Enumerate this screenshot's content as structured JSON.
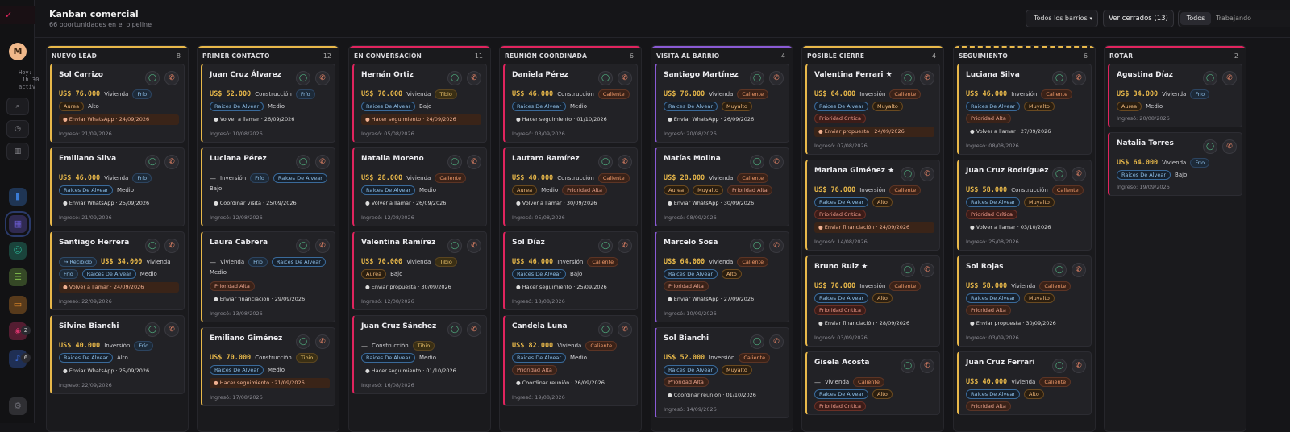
{
  "app": {
    "logo": "✓",
    "avatar": "M",
    "overlay": "Hoy:\n 1h 30\nactiv"
  },
  "sidebar": {
    "nav_top": [
      {
        "icon": "search-icon",
        "glyph": "⌕"
      },
      {
        "icon": "clock-icon",
        "glyph": "◷"
      },
      {
        "icon": "stats-icon",
        "glyph": "▥"
      }
    ],
    "nav_main": [
      {
        "icon": "chart-icon",
        "glyph": "▮",
        "color": "#3a7bd5"
      },
      {
        "icon": "kanban-icon",
        "glyph": "▦",
        "color": "#6a5acd"
      },
      {
        "icon": "users-icon",
        "glyph": "☺",
        "color": "#2aa58a"
      },
      {
        "icon": "tasks-icon",
        "glyph": "☰",
        "color": "#7ab34a"
      },
      {
        "icon": "chat-icon",
        "glyph": "▭",
        "color": "#e08a2a"
      },
      {
        "icon": "tag-icon",
        "glyph": "◈",
        "color": "#d6336c"
      },
      {
        "icon": "bell-icon",
        "glyph": "♪",
        "color": "#3a6ad5"
      },
      {
        "icon": "settings-icon",
        "glyph": "⚙",
        "color": "#6a6a72"
      }
    ],
    "badges": [
      "2",
      "6"
    ]
  },
  "header": {
    "title": "Kanban comercial",
    "subtitle": "66 oportunidades en el pipeline",
    "filter_selected": "Todos los barrios",
    "closed_button": "Ver cerrados (13)",
    "segments": [
      "Todos",
      "Trabajando"
    ]
  },
  "columns": [
    {
      "name": "NUEVO LEAD",
      "count": "8",
      "color": "#e8b84a",
      "dashed": false,
      "cards": [
        {
          "name": "Sol Carrizo",
          "money": "US$ 76.000",
          "type": "Vivienda",
          "tags": [
            {
              "t": "Frío",
              "c": "p-frio"
            }
          ],
          "tags2": [
            {
              "t": "Aurea",
              "c": "p-aur"
            }
          ],
          "tier": "Alto",
          "next": "Enviar WhatsApp · 24/09/2026",
          "nexthl": true,
          "ingreso": "Ingresó: 21/09/2026"
        },
        {
          "name": "Emiliano Silva",
          "money": "US$ 46.000",
          "type": "Vivienda",
          "tags": [
            {
              "t": "Frío",
              "c": "p-frio"
            }
          ],
          "tags2": [
            {
              "t": "Raices De Alvear",
              "c": "p-rda"
            }
          ],
          "tier": "Medio",
          "next": "Enviar WhatsApp · 25/09/2026",
          "nexthl": false,
          "ingreso": "Ingresó: 21/09/2026"
        },
        {
          "name": "Santiago Herrera",
          "pre": "↪ Recibido",
          "money": "US$ 34.000",
          "type": "Vivienda",
          "tags": [],
          "tags2": [
            {
              "t": "Frío",
              "c": "p-frio"
            },
            {
              "t": "Raices De Alvear",
              "c": "p-rda"
            }
          ],
          "tier": "Medio",
          "next": "Volver a llamar · 24/09/2026",
          "nexthl": true,
          "ingreso": "Ingresó: 22/09/2026"
        },
        {
          "name": "Silvina Bianchi",
          "money": "US$ 40.000",
          "type": "Inversión",
          "tags": [
            {
              "t": "Frío",
              "c": "p-frio"
            }
          ],
          "tags2": [
            {
              "t": "Raices De Alvear",
              "c": "p-rda"
            }
          ],
          "tier": "Alto",
          "next": "Enviar WhatsApp · 25/09/2026",
          "nexthl": false,
          "ingreso": "Ingresó: 22/09/2026"
        }
      ]
    },
    {
      "name": "PRIMER CONTACTO",
      "count": "12",
      "color": "#e8b84a",
      "dashed": false,
      "cards": [
        {
          "name": "Juan Cruz Álvarez",
          "money": "US$ 52.000",
          "type": "Construcción",
          "tags": [
            {
              "t": "Frío",
              "c": "p-frio"
            }
          ],
          "tags2": [
            {
              "t": "Raices De Alvear",
              "c": "p-rda"
            }
          ],
          "tier": "Medio",
          "next": "Volver a llamar · 26/09/2026",
          "nexthl": false,
          "ingreso": "Ingresó: 10/08/2026"
        },
        {
          "name": "Luciana Pérez",
          "dash": true,
          "money": "",
          "type": "Inversión",
          "tags": [
            {
              "t": "Frío",
              "c": "p-frio"
            },
            {
              "t": "Raices De Alvear",
              "c": "p-rda"
            }
          ],
          "tags2": [],
          "tier": "Bajo",
          "next": "Coordinar visita · 25/09/2026",
          "nexthl": false,
          "ingreso": "Ingresó: 12/08/2026"
        },
        {
          "name": "Laura Cabrera",
          "dash": true,
          "money": "",
          "type": "Vivienda",
          "tags": [
            {
              "t": "Frío",
              "c": "p-frio"
            },
            {
              "t": "Raices De Alvear",
              "c": "p-rda"
            }
          ],
          "tags2": [],
          "tier": "Medio",
          "prio": {
            "t": "Prioridad Alta",
            "c": "p-pri"
          },
          "next": "Enviar financiación · 29/09/2026",
          "nexthl": false,
          "ingreso": "Ingresó: 13/08/2026"
        },
        {
          "name": "Emiliano Giménez",
          "money": "US$ 70.000",
          "type": "Construcción",
          "tags": [
            {
              "t": "Tibio",
              "c": "p-tibio"
            }
          ],
          "tags2": [
            {
              "t": "Raices De Alvear",
              "c": "p-rda"
            }
          ],
          "tier": "Medio",
          "next": "Hacer seguimiento · 21/09/2026",
          "nexthl": true,
          "ingreso": "Ingresó: 17/08/2026"
        }
      ]
    },
    {
      "name": "EN CONVERSACIÓN",
      "count": "11",
      "color": "#e0245e",
      "dashed": false,
      "cards": [
        {
          "name": "Hernán Ortiz",
          "money": "US$ 70.000",
          "type": "Vivienda",
          "tags": [
            {
              "t": "Tibio",
              "c": "p-tibio"
            }
          ],
          "tags2": [
            {
              "t": "Raices De Alvear",
              "c": "p-rda"
            }
          ],
          "tier": "Bajo",
          "next": "Hacer seguimiento · 24/09/2026",
          "nexthl": true,
          "ingreso": "Ingresó: 05/08/2026"
        },
        {
          "name": "Natalia Moreno",
          "money": "US$ 28.000",
          "type": "Vivienda",
          "tags": [
            {
              "t": "Caliente",
              "c": "p-cal"
            }
          ],
          "tags2": [
            {
              "t": "Raices De Alvear",
              "c": "p-rda"
            }
          ],
          "tier": "Medio",
          "next": "Volver a llamar · 26/09/2026",
          "nexthl": false,
          "ingreso": "Ingresó: 12/08/2026"
        },
        {
          "name": "Valentina Ramírez",
          "money": "US$ 70.000",
          "type": "Vivienda",
          "tags": [
            {
              "t": "Tibio",
              "c": "p-tibio"
            }
          ],
          "tags2": [
            {
              "t": "Aurea",
              "c": "p-aur"
            }
          ],
          "tier": "Bajo",
          "next": "Enviar propuesta · 30/09/2026",
          "nexthl": false,
          "ingreso": "Ingresó: 12/08/2026"
        },
        {
          "name": "Juan Cruz Sánchez",
          "dash": true,
          "money": "",
          "type": "Construcción",
          "tags": [
            {
              "t": "Tibio",
              "c": "p-tibio"
            }
          ],
          "tags2": [
            {
              "t": "Raices De Alvear",
              "c": "p-rda"
            }
          ],
          "tier": "Medio",
          "next": "Hacer seguimiento · 01/10/2026",
          "nexthl": false,
          "ingreso": "Ingresó: 16/08/2026"
        }
      ]
    },
    {
      "name": "REUNIÓN COORDINADA",
      "count": "6",
      "color": "#e0245e",
      "dashed": false,
      "cards": [
        {
          "name": "Daniela Pérez",
          "money": "US$ 46.000",
          "type": "Construcción",
          "tags": [
            {
              "t": "Caliente",
              "c": "p-cal"
            }
          ],
          "tags2": [
            {
              "t": "Raices De Alvear",
              "c": "p-rda"
            }
          ],
          "tier": "Medio",
          "next": "Hacer seguimiento · 01/10/2026",
          "nexthl": false,
          "ingreso": "Ingresó: 03/09/2026"
        },
        {
          "name": "Lautaro Ramírez",
          "money": "US$ 40.000",
          "type": "Construcción",
          "tags": [
            {
              "t": "Caliente",
              "c": "p-cal"
            }
          ],
          "tags2": [
            {
              "t": "Aurea",
              "c": "p-aur"
            }
          ],
          "tier": "Medio",
          "prioInline": {
            "t": "Prioridad Alta",
            "c": "p-pri"
          },
          "next": "Volver a llamar · 30/09/2026",
          "nexthl": false,
          "ingreso": "Ingresó: 05/08/2026"
        },
        {
          "name": "Sol Díaz",
          "money": "US$ 46.000",
          "type": "Inversión",
          "tags": [
            {
              "t": "Caliente",
              "c": "p-cal"
            }
          ],
          "tags2": [
            {
              "t": "Raices De Alvear",
              "c": "p-rda"
            }
          ],
          "tier": "Bajo",
          "next": "Hacer seguimiento · 25/09/2026",
          "nexthl": false,
          "ingreso": "Ingresó: 18/08/2026"
        },
        {
          "name": "Candela Luna",
          "money": "US$ 82.000",
          "type": "Vivienda",
          "tags": [
            {
              "t": "Caliente",
              "c": "p-cal"
            }
          ],
          "tags2": [
            {
              "t": "Raices De Alvear",
              "c": "p-rda"
            }
          ],
          "tier": "Medio",
          "prio": {
            "t": "Prioridad Alta",
            "c": "p-pri"
          },
          "next": "Coordinar reunión · 26/09/2026",
          "nexthl": false,
          "ingreso": "Ingresó: 19/08/2026"
        }
      ]
    },
    {
      "name": "VISITA AL BARRIO",
      "count": "4",
      "color": "#8a5ad5",
      "dashed": false,
      "cards": [
        {
          "name": "Santiago Martínez",
          "money": "US$ 76.000",
          "type": "Vivienda",
          "tags": [
            {
              "t": "Caliente",
              "c": "p-cal"
            }
          ],
          "tags2": [
            {
              "t": "Raices De Alvear",
              "c": "p-rda"
            }
          ],
          "tier": "Muyalto",
          "tierpill": true,
          "next": "Enviar WhatsApp · 26/09/2026",
          "nexthl": false,
          "ingreso": "Ingresó: 20/08/2026"
        },
        {
          "name": "Matías Molina",
          "money": "US$ 28.000",
          "type": "Vivienda",
          "tags": [
            {
              "t": "Caliente",
              "c": "p-cal"
            }
          ],
          "tags2": [
            {
              "t": "Aurea",
              "c": "p-aur"
            }
          ],
          "tier": "Muyalto",
          "tierpill": true,
          "prioInline": {
            "t": "Prioridad Alta",
            "c": "p-pri"
          },
          "next": "Enviar WhatsApp · 30/09/2026",
          "nexthl": false,
          "ingreso": "Ingresó: 08/09/2026"
        },
        {
          "name": "Marcelo Sosa",
          "money": "US$ 64.000",
          "type": "Vivienda",
          "tags": [
            {
              "t": "Caliente",
              "c": "p-cal"
            }
          ],
          "tags2": [
            {
              "t": "Raices De Alvear",
              "c": "p-rda"
            }
          ],
          "tier": "Alto",
          "tierpill": true,
          "prio": {
            "t": "Prioridad Alta",
            "c": "p-pri"
          },
          "next": "Enviar WhatsApp · 27/09/2026",
          "nexthl": false,
          "ingreso": "Ingresó: 10/09/2026"
        },
        {
          "name": "Sol Bianchi",
          "money": "US$ 52.000",
          "type": "Inversión",
          "tags": [
            {
              "t": "Caliente",
              "c": "p-cal"
            }
          ],
          "tags2": [
            {
              "t": "Raices De Alvear",
              "c": "p-rda"
            }
          ],
          "tier": "Muyalto",
          "tierpill": true,
          "prio": {
            "t": "Prioridad Alta",
            "c": "p-pri"
          },
          "next": "Coordinar reunión · 01/10/2026",
          "nexthl": false,
          "ingreso": "Ingresó: 14/09/2026"
        }
      ]
    },
    {
      "name": "POSIBLE CIERRE",
      "count": "4",
      "color": "#e8b84a",
      "dashed": false,
      "cards": [
        {
          "name": "Valentina Ferrari ★",
          "money": "US$ 64.000",
          "type": "Inversión",
          "tags": [
            {
              "t": "Caliente",
              "c": "p-cal"
            }
          ],
          "tags2": [
            {
              "t": "Raices De Alvear",
              "c": "p-rda"
            }
          ],
          "tier": "Muyalto",
          "tierpill": true,
          "prio": {
            "t": "Prioridad Crítica",
            "c": "p-prc"
          },
          "next": "Enviar propuesta · 24/09/2026",
          "nexthl": true,
          "ingreso": "Ingresó: 07/08/2026"
        },
        {
          "name": "Mariana Giménez ★",
          "money": "US$ 76.000",
          "type": "Inversión",
          "tags": [
            {
              "t": "Caliente",
              "c": "p-cal"
            }
          ],
          "tags2": [
            {
              "t": "Raices De Alvear",
              "c": "p-rda"
            }
          ],
          "tier": "Alto",
          "tierpill": true,
          "prio": {
            "t": "Prioridad Crítica",
            "c": "p-prc"
          },
          "next": "Enviar financiación · 24/09/2026",
          "nexthl": true,
          "ingreso": "Ingresó: 14/08/2026"
        },
        {
          "name": "Bruno Ruiz ★",
          "money": "US$ 70.000",
          "type": "Inversión",
          "tags": [
            {
              "t": "Caliente",
              "c": "p-cal"
            }
          ],
          "tags2": [
            {
              "t": "Raices De Alvear",
              "c": "p-rda"
            }
          ],
          "tier": "Alto",
          "tierpill": true,
          "prio": {
            "t": "Prioridad Crítica",
            "c": "p-prc"
          },
          "next": "Enviar financiación · 28/09/2026",
          "nexthl": false,
          "ingreso": "Ingresó: 03/09/2026"
        },
        {
          "name": "Gisela Acosta",
          "dash": true,
          "money": "",
          "type": "Vivienda",
          "tags": [
            {
              "t": "Caliente",
              "c": "p-cal"
            }
          ],
          "tags2": [
            {
              "t": "Raices De Alvear",
              "c": "p-rda"
            }
          ],
          "tier": "Alto",
          "tierpill": true,
          "prio": {
            "t": "Prioridad Crítica",
            "c": "p-prc"
          },
          "next": "",
          "nexthl": false,
          "ingreso": ""
        }
      ]
    },
    {
      "name": "SEGUIMIENTO",
      "count": "6",
      "color": "#e8b84a",
      "dashed": true,
      "cards": [
        {
          "name": "Luciana Silva",
          "money": "US$ 46.000",
          "type": "Inversión",
          "tags": [
            {
              "t": "Caliente",
              "c": "p-cal"
            }
          ],
          "tags2": [
            {
              "t": "Raices De Alvear",
              "c": "p-rda"
            }
          ],
          "tier": "Muyalto",
          "tierpill": true,
          "prio": {
            "t": "Prioridad Alta",
            "c": "p-pri"
          },
          "next": "Volver a llamar · 27/09/2026",
          "nexthl": false,
          "ingreso": "Ingresó: 08/08/2026"
        },
        {
          "name": "Juan Cruz Rodríguez",
          "money": "US$ 58.000",
          "type": "Construcción",
          "tags": [
            {
              "t": "Caliente",
              "c": "p-cal"
            }
          ],
          "tags2": [
            {
              "t": "Raices De Alvear",
              "c": "p-rda"
            }
          ],
          "tier": "Muyalto",
          "tierpill": true,
          "prio": {
            "t": "Prioridad Crítica",
            "c": "p-prc"
          },
          "next": "Volver a llamar · 03/10/2026",
          "nexthl": false,
          "ingreso": "Ingresó: 25/08/2026"
        },
        {
          "name": "Sol Rojas",
          "money": "US$ 58.000",
          "type": "Vivienda",
          "tags": [
            {
              "t": "Caliente",
              "c": "p-cal"
            }
          ],
          "tags2": [
            {
              "t": "Raices De Alvear",
              "c": "p-rda"
            }
          ],
          "tier": "Muyalto",
          "tierpill": true,
          "prio": {
            "t": "Prioridad Alta",
            "c": "p-pri"
          },
          "next": "Enviar propuesta · 30/09/2026",
          "nexthl": false,
          "ingreso": "Ingresó: 03/09/2026"
        },
        {
          "name": "Juan Cruz Ferrari",
          "money": "US$ 40.000",
          "type": "Vivienda",
          "tags": [
            {
              "t": "Caliente",
              "c": "p-cal"
            }
          ],
          "tags2": [
            {
              "t": "Raices De Alvear",
              "c": "p-rda"
            }
          ],
          "tier": "Alto",
          "tierpill": true,
          "prio": {
            "t": "Prioridad Alta",
            "c": "p-pri"
          },
          "next": "",
          "nexthl": false,
          "ingreso": ""
        }
      ]
    },
    {
      "name": "ROTAR",
      "count": "2",
      "color": "#e0245e",
      "dashed": false,
      "cards": [
        {
          "name": "Agustina Díaz",
          "money": "US$ 34.000",
          "type": "Vivienda",
          "tags": [
            {
              "t": "Frío",
              "c": "p-frio"
            }
          ],
          "tags2": [
            {
              "t": "Aurea",
              "c": "p-aur"
            }
          ],
          "tier": "Medio",
          "next": "",
          "nexthl": false,
          "ingreso": "Ingresó: 20/08/2026"
        },
        {
          "name": "Natalia Torres",
          "money": "US$ 64.000",
          "type": "Vivienda",
          "tags": [
            {
              "t": "Frío",
              "c": "p-frio"
            }
          ],
          "tags2": [
            {
              "t": "Raices De Alvear",
              "c": "p-rda"
            }
          ],
          "tier": "Bajo",
          "next": "",
          "nexthl": false,
          "ingreso": "Ingresó: 19/09/2026"
        }
      ]
    }
  ]
}
